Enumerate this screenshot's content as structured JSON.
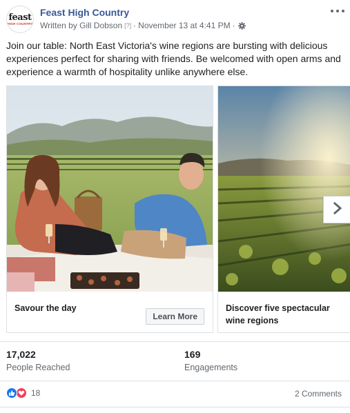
{
  "post": {
    "page_name": "Feast High Country",
    "avatar_logo_word": "feast",
    "avatar_logo_sub": "HIGH COUNTRY",
    "written_by": "Written by Gill Dobson",
    "help_marker": "[?]",
    "separator": "·",
    "timestamp": "November 13 at 4:41 PM",
    "text": "Join our table: North East Victoria's wine regions are bursting with delicious experiences perfect for sharing with friends. Be welcomed with open arms and experience a warmth of hospitality unlike anywhere else."
  },
  "carousel": {
    "cards": [
      {
        "title": "Savour the day",
        "cta": "Learn More"
      },
      {
        "title": "Discover five spectacular wine regions"
      }
    ]
  },
  "stats": {
    "reach_value": "17,022",
    "reach_label": "People Reached",
    "engagement_value": "169",
    "engagement_label": "Engagements"
  },
  "footer": {
    "reaction_count": "18",
    "comments": "2 Comments"
  },
  "colors": {
    "link": "#385898",
    "like": "#1877f2",
    "love": "#f33e58"
  }
}
